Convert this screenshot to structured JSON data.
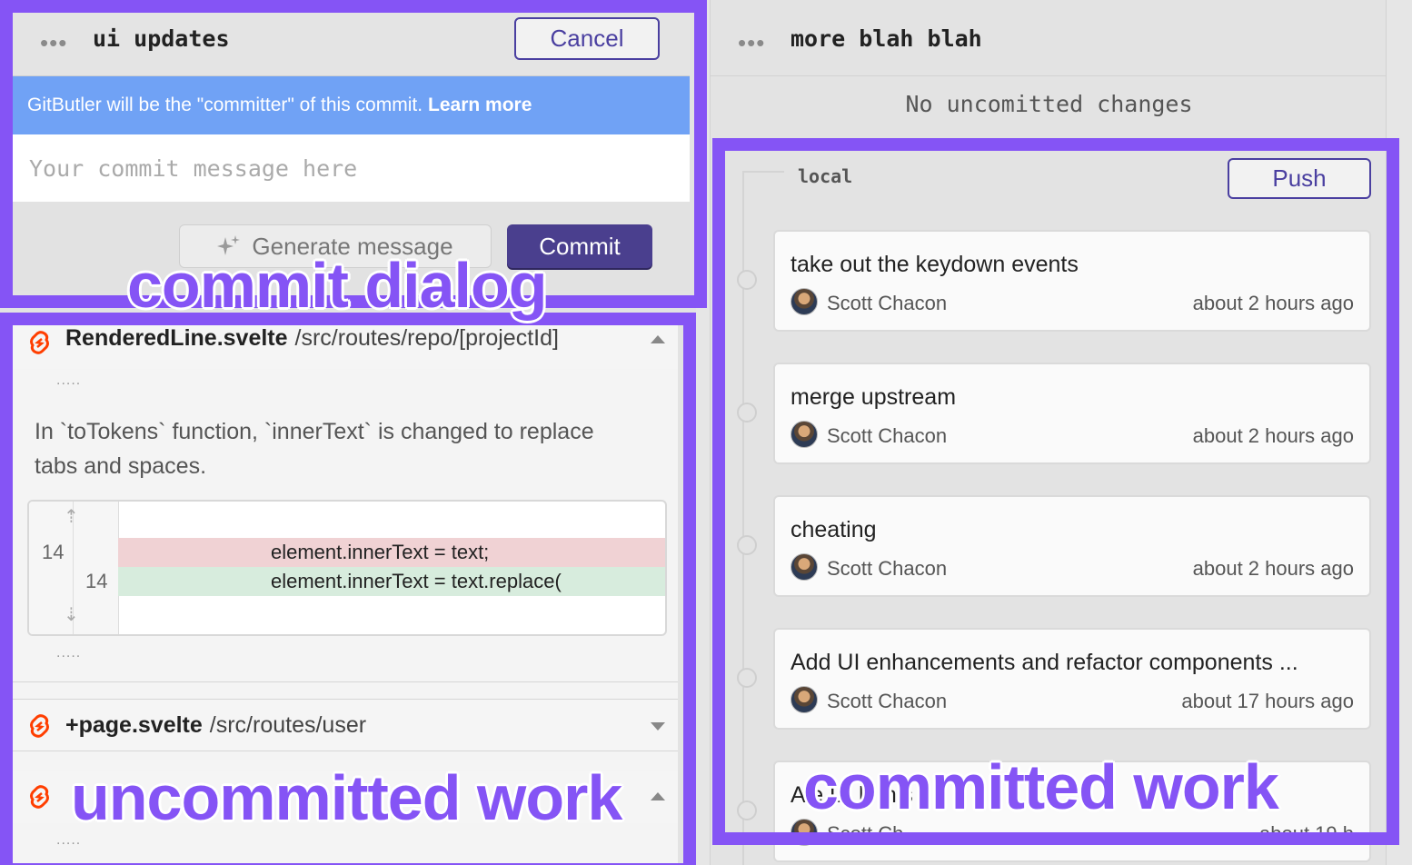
{
  "commit_lane": {
    "title": "ui updates",
    "dots": "•••",
    "cancel_label": "Cancel",
    "banner_text": "GitButler will be the \"committer\" of this commit.",
    "banner_link": "Learn more",
    "commit_placeholder": "Your commit message here",
    "generate_label": "Generate message",
    "commit_label": "Commit"
  },
  "files": [
    {
      "name": "RenderedLine.svelte",
      "path": "/src/routes/repo/[projectId]",
      "expanded": true,
      "summary": "In `toTokens` function, `innerText` is changed to replace tabs and spaces.",
      "hunk": {
        "removed": {
          "old_line": "14",
          "code": "element.innerText = text;"
        },
        "added": {
          "new_line": "14",
          "code": "element.innerText = text.replace("
        }
      }
    },
    {
      "name": "+page.svelte",
      "path": "/src/routes/user",
      "expanded": false
    }
  ],
  "diff_ellipsis": ".....",
  "branch_lane": {
    "title": "more blah blah",
    "dots": "•••",
    "no_changes": "No uncomitted changes",
    "local_label": "local",
    "push_label": "Push",
    "commits": [
      {
        "message": "take out the keydown events",
        "author": "Scott Chacon",
        "time": "about 2 hours ago"
      },
      {
        "message": "merge upstream",
        "author": "Scott Chacon",
        "time": "about 2 hours ago"
      },
      {
        "message": "cheating",
        "author": "Scott Chacon",
        "time": "about 2 hours ago"
      },
      {
        "message": "Add UI enhancements and refactor components ...",
        "author": "Scott Chacon",
        "time": "about 17 hours ago"
      },
      {
        "message": "A                 e        UI         h  this ...",
        "author": "Scott Ch",
        "time": "about 19 h"
      }
    ]
  },
  "annotations": {
    "commit_dialog": "commit dialog",
    "uncommitted_work": "uncommitted work",
    "committed_work": "committed work"
  },
  "colors": {
    "annotation_purple": "#8554f5",
    "banner_blue": "#70a2f5",
    "commit_button": "#4a3f8e",
    "svelte_orange": "#ff3e00",
    "diff_removed": "#f0d2d4",
    "diff_added": "#d7ecdd"
  },
  "icons": [
    "more-dots-icon",
    "sparkle-icon",
    "svelte-icon",
    "caret-up-icon",
    "caret-down-icon",
    "expand-up-icon",
    "expand-down-icon",
    "avatar"
  ]
}
